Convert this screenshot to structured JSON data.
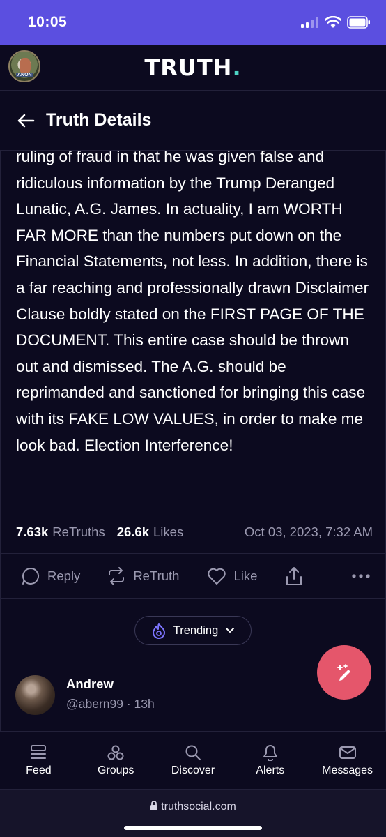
{
  "status_bar": {
    "time": "10:05"
  },
  "header": {
    "logo": "TRUTH",
    "logo_dot": ".",
    "avatar_tag": "ANON"
  },
  "title_bar": {
    "title": "Truth Details"
  },
  "post": {
    "body": "ruling of fraud in that he was given false and ridiculous information by the Trump Deranged Lunatic, A.G. James. In actuality, I am WORTH FAR MORE than the numbers put down on the Financial Statements, not less. In addition, there is a far reaching and professionally drawn Disclaimer Clause boldly stated on the FIRST PAGE OF THE DOCUMENT. This entire case should be thrown out and dismissed. The A.G. should be reprimanded and sanctioned for bringing this case with its FAKE LOW VALUES, in order to make me look bad. Election Interference!",
    "retruths_count": "7.63k",
    "retruths_label": "ReTruths",
    "likes_count": "26.6k",
    "likes_label": "Likes",
    "timestamp": "Oct 03, 2023, 7:32 AM"
  },
  "actions": {
    "reply": "Reply",
    "retruth": "ReTruth",
    "like": "Like"
  },
  "trending": {
    "label": "Trending"
  },
  "reply_preview": {
    "name": "Andrew",
    "handle": "@abern99 · 13h"
  },
  "bottom_nav": {
    "feed": "Feed",
    "groups": "Groups",
    "discover": "Discover",
    "alerts": "Alerts",
    "messages": "Messages"
  },
  "url_bar": {
    "url": "truthsocial.com"
  },
  "colors": {
    "status_bar": "#5b4fe0",
    "background": "#0c0a1f",
    "fab": "#e5566b",
    "logo_accent": "#4dd4c4",
    "trending_icon": "#7d74ff"
  },
  "icons": [
    "signal-icon",
    "wifi-icon",
    "battery-icon",
    "back-arrow-icon",
    "reply-icon",
    "retruth-icon",
    "like-icon",
    "share-icon",
    "more-icon",
    "trending-icon",
    "chevron-down-icon",
    "compose-icon",
    "feed-icon",
    "groups-icon",
    "discover-icon",
    "alerts-icon",
    "messages-icon",
    "lock-icon"
  ]
}
